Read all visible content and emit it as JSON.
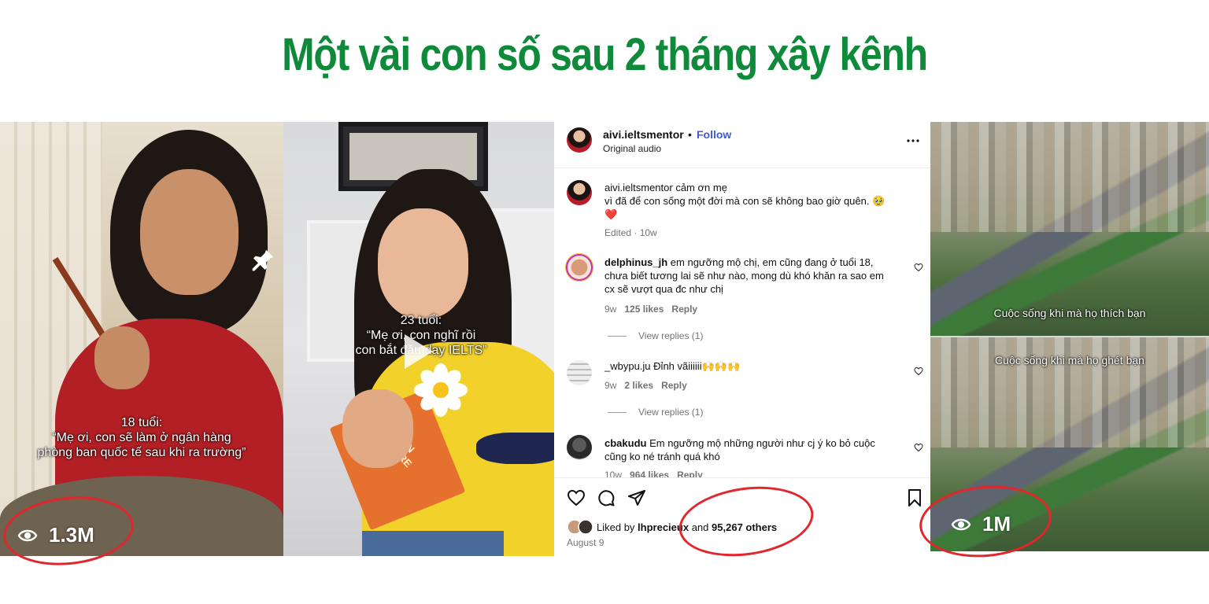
{
  "title": "Một vài con số sau 2 tháng xây kênh",
  "panel1": {
    "caption_line1": "18 tuổi:",
    "caption_line2": "“Mẹ ơi, con sẽ làm ở ngân hàng",
    "caption_line3": "phòng ban quốc tế sau khi ra trường”",
    "views": "1.3M"
  },
  "panel2": {
    "caption_line1": "23 tuổi:",
    "caption_line2": "“Mẹ ơi, con nghĩ rồi",
    "caption_line3": "con bắt đầu dạy IELTS”",
    "book_text": "AMERICAN LITERATURE"
  },
  "instagram": {
    "username": "aivi.ieltsmentor",
    "dot": "•",
    "follow": "Follow",
    "audio": "Original audio",
    "post": {
      "username": "aivi.ieltsmentor",
      "text1": "cảm ơn mẹ",
      "text2": "vì đã để con sống một đời mà con sẽ không bao giờ quên. 🥹",
      "text3": "❤️",
      "meta": "Edited · 10w"
    },
    "comments": [
      {
        "username": "delphinus_jh",
        "line1": "em ngưỡng mộ chị, em cũng đang ở tuổi 18,",
        "line2": "chưa biết tương lai sẽ như nào, mong dù khó khăn ra sao em",
        "line3": "cx sẽ vượt qua đc như chị",
        "time": "9w",
        "likes": "125 likes",
        "reply": "Reply",
        "view_replies": "View replies (1)"
      },
      {
        "username": "_wbypu.ju",
        "line1": "Đỉnh vãiiiiii🙌🙌🙌",
        "time": "9w",
        "likes": "2 likes",
        "reply": "Reply",
        "view_replies": "View replies (1)"
      },
      {
        "username": "cbakudu",
        "line1": "Em ngưỡng mộ những người như cj ý ko bỏ cuộc",
        "line2": "cũng ko né tránh quá khó",
        "time": "10w",
        "likes": "964 likes",
        "reply": "Reply"
      }
    ],
    "liked_prefix": "Liked by",
    "liked_user": "lhprecieux",
    "liked_and": "and",
    "liked_count": "95,267 others",
    "date": "August 9"
  },
  "panel4": {
    "caption_top": "Cuộc sống khi mà họ thích bạn",
    "caption_bottom": "Cuộc sống khi mà họ ghét bạn",
    "views": "1M"
  },
  "colors": {
    "title_green": "#0e8a3a",
    "highlight_red": "#e2262c",
    "follow_blue": "#3c5cd6"
  },
  "icons": [
    "pin-icon",
    "play-icon",
    "flower-icon",
    "more-icon",
    "heart-icon",
    "comment-icon",
    "share-icon",
    "bookmark-icon",
    "eye-icon"
  ]
}
